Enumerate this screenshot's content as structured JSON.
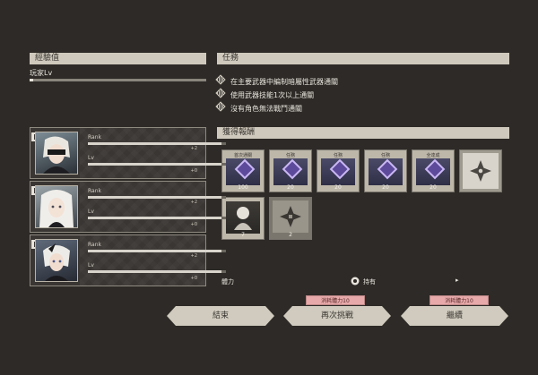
{
  "exp": {
    "header": "經驗值",
    "player_label": "玩家Lv",
    "progress": 0.02
  },
  "mission": {
    "header": "任務",
    "items": [
      "在主要武器中編制暗屬性武器通關",
      "使用武器技能1次以上通關",
      "沒有角色無法戰鬥通關"
    ]
  },
  "rewards": {
    "header": "獲得報酬",
    "row1": [
      {
        "label": "首次通關",
        "qty": "100"
      },
      {
        "label": "任務",
        "qty": "20"
      },
      {
        "label": "任務",
        "qty": "20"
      },
      {
        "label": "任務",
        "qty": "20"
      },
      {
        "label": "全達成",
        "qty": "20"
      }
    ],
    "row2_qty": [
      "7",
      "2"
    ]
  },
  "characters": [
    {
      "rank_label": "Rank",
      "rank_gain": "+2",
      "rank_progress": 0.97,
      "lv_label": "Lv",
      "lv_gain": "+0",
      "lv_progress": 0.97
    },
    {
      "rank_label": "Rank",
      "rank_gain": "+2",
      "rank_progress": 0.97,
      "lv_label": "Lv",
      "lv_gain": "+0",
      "lv_progress": 0.97
    },
    {
      "rank_label": "Rank",
      "rank_gain": "+2",
      "rank_progress": 0.97,
      "lv_label": "Lv",
      "lv_gain": "+0",
      "lv_progress": 0.97
    }
  ],
  "stamina": {
    "label": "體力",
    "held_label": "持有"
  },
  "buttons": {
    "end": "結束",
    "retry": "再次挑戰",
    "retry_cost": "消耗體力10",
    "continue": "繼續",
    "continue_cost": "消耗體力10"
  }
}
